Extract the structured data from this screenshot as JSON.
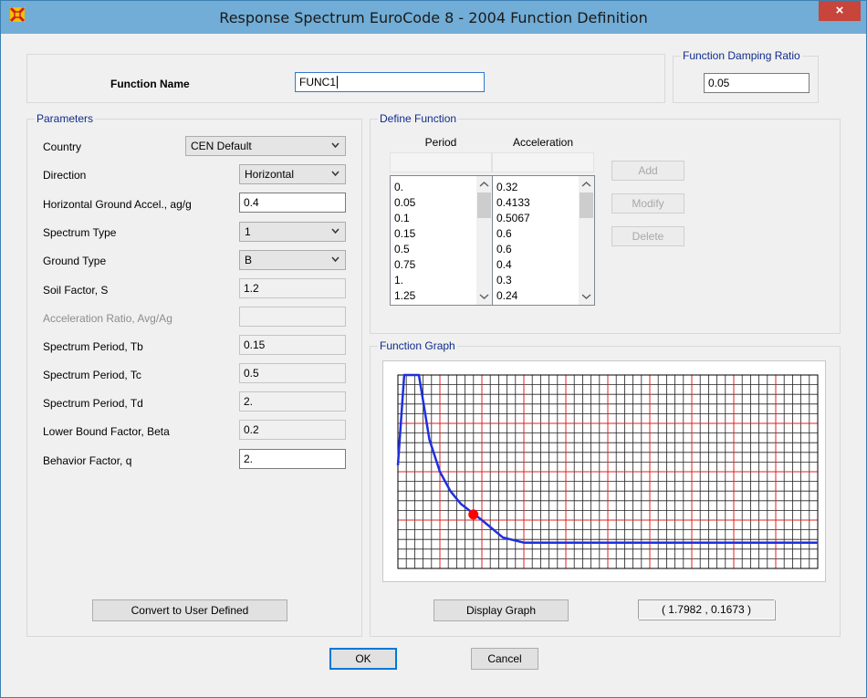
{
  "window": {
    "title": "Response Spectrum EuroCode 8 - 2004 Function Definition",
    "close_glyph": "×"
  },
  "function_name": {
    "label": "Function Name",
    "value": "FUNC1"
  },
  "damping": {
    "legend": "Function Damping Ratio",
    "value": "0.05"
  },
  "parameters": {
    "legend": "Parameters",
    "country": {
      "label": "Country",
      "value": "CEN Default"
    },
    "direction": {
      "label": "Direction",
      "value": "Horizontal"
    },
    "ag": {
      "label": "Horizontal Ground Accel.,  ag/g",
      "value": "0.4"
    },
    "spectrum_type": {
      "label": "Spectrum Type",
      "value": "1"
    },
    "ground_type": {
      "label": "Ground Type",
      "value": "B"
    },
    "soil_factor": {
      "label": "Soil Factor, S",
      "value": "1.2"
    },
    "accel_ratio": {
      "label": "Acceleration Ratio,  Avg/Ag",
      "value": ""
    },
    "tb": {
      "label": "Spectrum Period, Tb",
      "value": "0.15"
    },
    "tc": {
      "label": "Spectrum Period, Tc",
      "value": "0.5"
    },
    "td": {
      "label": "Spectrum Period, Td",
      "value": "2."
    },
    "beta": {
      "label": "Lower Bound Factor, Beta",
      "value": "0.2"
    },
    "q": {
      "label": "Behavior Factor, q",
      "value": "2."
    },
    "convert_button": "Convert to User Defined"
  },
  "define_function": {
    "legend": "Define Function",
    "period_header": "Period",
    "accel_header": "Acceleration",
    "periods": [
      "0.",
      "0.05",
      "0.1",
      "0.15",
      "0.5",
      "0.75",
      "1.",
      "1.25"
    ],
    "accelerations": [
      "0.32",
      "0.4133",
      "0.5067",
      "0.6",
      "0.6",
      "0.4",
      "0.3",
      "0.24"
    ],
    "add_button": "Add",
    "modify_button": "Modify",
    "delete_button": "Delete"
  },
  "function_graph": {
    "legend": "Function Graph",
    "display_button": "Display Graph",
    "coordinates": "( 1.7982  ,  0.1673 )"
  },
  "footer": {
    "ok_button": "OK",
    "cancel_button": "Cancel"
  },
  "colors": {
    "titlebar": "#71add6",
    "close": "#c7453a",
    "legend_text": "#102c8c",
    "curve": "#1f2fe0",
    "grid_major": "#e02020",
    "grid_minor": "#222222",
    "marker": "#ff0000"
  },
  "chart_data": {
    "type": "line",
    "x": [
      0,
      0.05,
      0.1,
      0.15,
      0.5,
      0.75,
      1.0,
      1.25,
      1.5,
      2.0,
      2.5,
      3.0,
      4.0,
      5.0,
      6.0,
      8.0,
      10.0
    ],
    "y": [
      0.32,
      0.4133,
      0.5067,
      0.6,
      0.6,
      0.4,
      0.3,
      0.24,
      0.2,
      0.15,
      0.096,
      0.08,
      0.08,
      0.08,
      0.08,
      0.08,
      0.08
    ],
    "series": [
      {
        "values": [
          0.32,
          0.4133,
          0.5067,
          0.6,
          0.6,
          0.4,
          0.3,
          0.24,
          0.2,
          0.15,
          0.096,
          0.08,
          0.08,
          0.08,
          0.08,
          0.08,
          0.08
        ]
      }
    ],
    "marker": {
      "x": 1.7982,
      "y": 0.1673
    },
    "xlim": [
      0,
      10
    ],
    "ylim": [
      0,
      0.6
    ],
    "grid": true,
    "title": "",
    "xlabel": "",
    "ylabel": ""
  }
}
